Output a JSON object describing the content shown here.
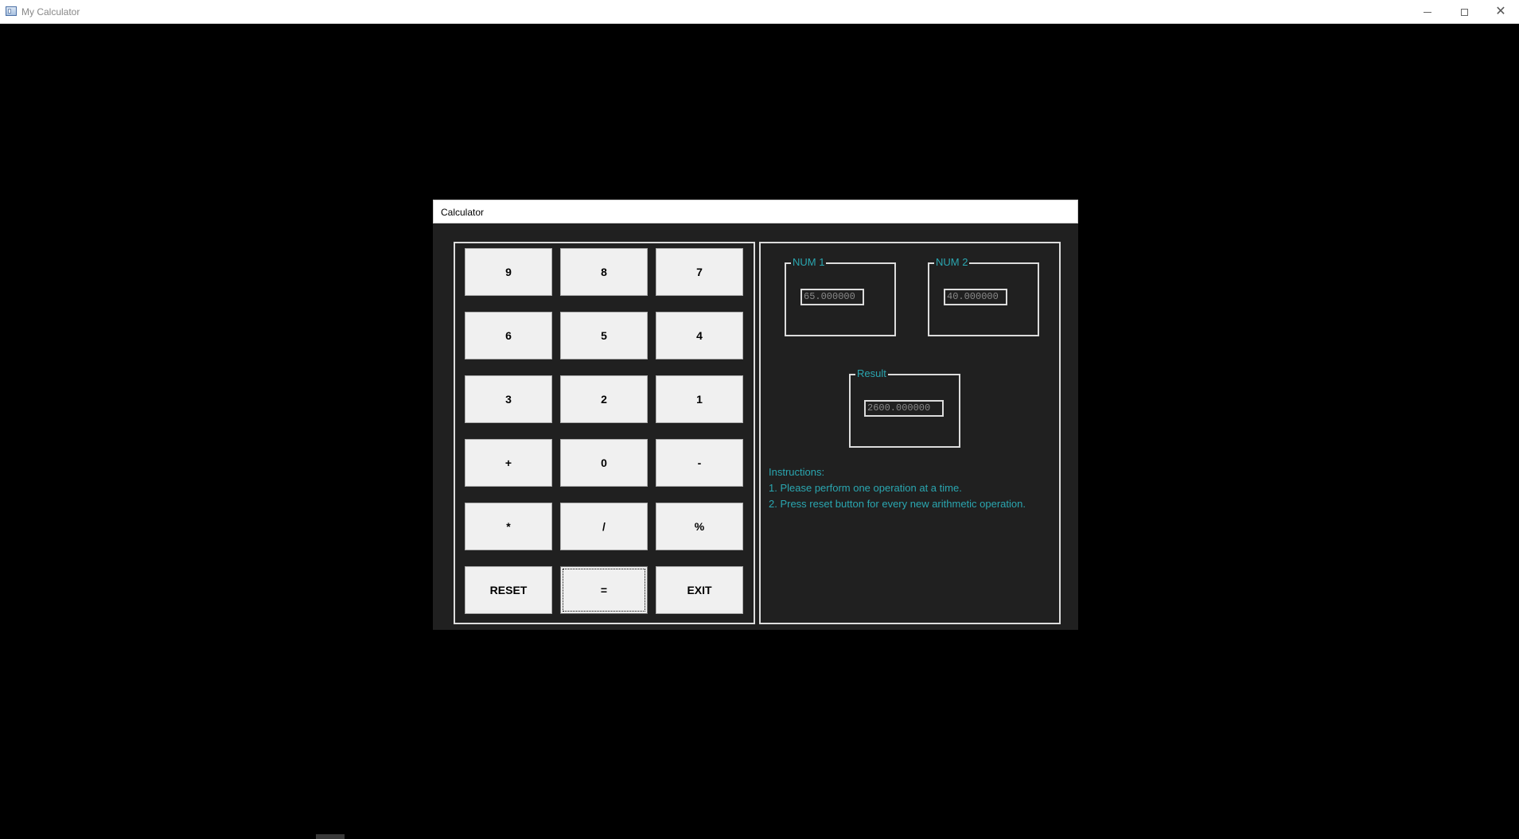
{
  "window": {
    "title": "My Calculator",
    "icon": "app-window-icon"
  },
  "dialog": {
    "title": "Calculator"
  },
  "keypad": {
    "rows": [
      [
        "9",
        "8",
        "7"
      ],
      [
        "6",
        "5",
        "4"
      ],
      [
        "3",
        "2",
        "1"
      ],
      [
        "+",
        "0",
        "-"
      ],
      [
        "*",
        "/",
        "%"
      ],
      [
        "RESET",
        "=",
        "EXIT"
      ]
    ]
  },
  "inputs": {
    "num1": {
      "label": "NUM 1",
      "value": "65.000000"
    },
    "num2": {
      "label": "NUM 2",
      "value": "40.000000"
    },
    "result": {
      "label": "Result",
      "value": "2600.000000"
    }
  },
  "instructions": {
    "heading": "Instructions:",
    "line1": "1. Please perform one operation at a time.",
    "line2": "2. Press reset button for every new arithmetic operation."
  },
  "colors": {
    "background": "#000000",
    "panel": "#202020",
    "accent_text": "#2aa6b0",
    "button_face": "#f0f0f0"
  }
}
